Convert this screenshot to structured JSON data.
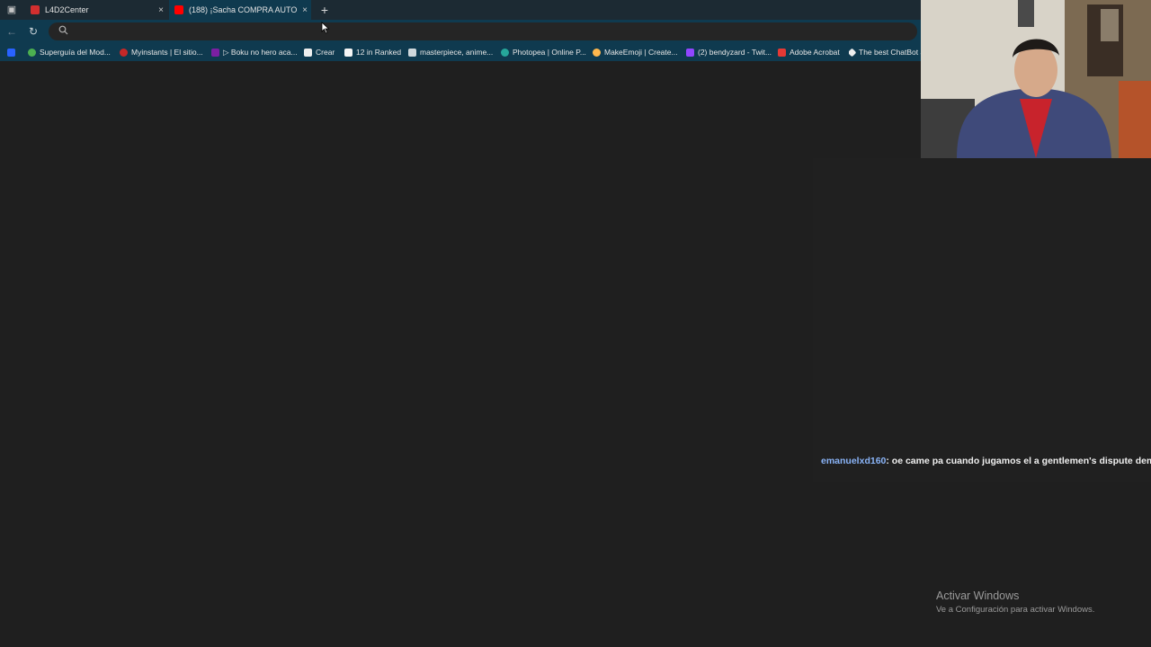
{
  "browser": {
    "tabs": [
      {
        "title": "L4D2Center",
        "favicon_color": "#d32f2f",
        "active": false
      },
      {
        "title": "(188) ¡Sacha COMPRA AUTO",
        "favicon_color": "#ff0000",
        "active": true
      }
    ],
    "close_glyph": "×",
    "newtab_glyph": "+",
    "back_glyph": "←",
    "reload_glyph": "↻",
    "search_glyph": "🔍",
    "omnibox": {
      "value": "",
      "placeholder": ""
    },
    "bookmarks": [
      {
        "label": "Superguía del Mod...",
        "icon_color": "#4caf50"
      },
      {
        "label": "Myinstants | El sitio...",
        "icon_color": "#c62828"
      },
      {
        "label": "▷ Boku no hero aca...",
        "icon_color": "#7b1fa2"
      },
      {
        "label": "Crear",
        "icon_color": "#eeeeee"
      },
      {
        "label": "12 in Ranked",
        "icon_color": "#f5f5f5"
      },
      {
        "label": "masterpiece, anime...",
        "icon_color": "#cfd8dc"
      },
      {
        "label": "Photopea | Online P...",
        "icon_color": "#26a69a"
      },
      {
        "label": "MakeEmoji | Create...",
        "icon_color": "#ffb74d"
      },
      {
        "label": "(2) bendyzard - Twit...",
        "icon_color": "#9146ff"
      },
      {
        "label": "Adobe Acrobat",
        "icon_color": "#e53935"
      },
      {
        "label": "The best ChatBot a",
        "icon_color": "#eeeeee"
      }
    ]
  },
  "chat": {
    "messages": [
      {
        "user": "emanuelxd160",
        "text": ": oe came pa cuando jugamos el a gentlemen's dispute demo"
      }
    ]
  },
  "watermark": {
    "line1": "Activar Windows",
    "line2": "Ve a Configuración para activar Windows."
  }
}
